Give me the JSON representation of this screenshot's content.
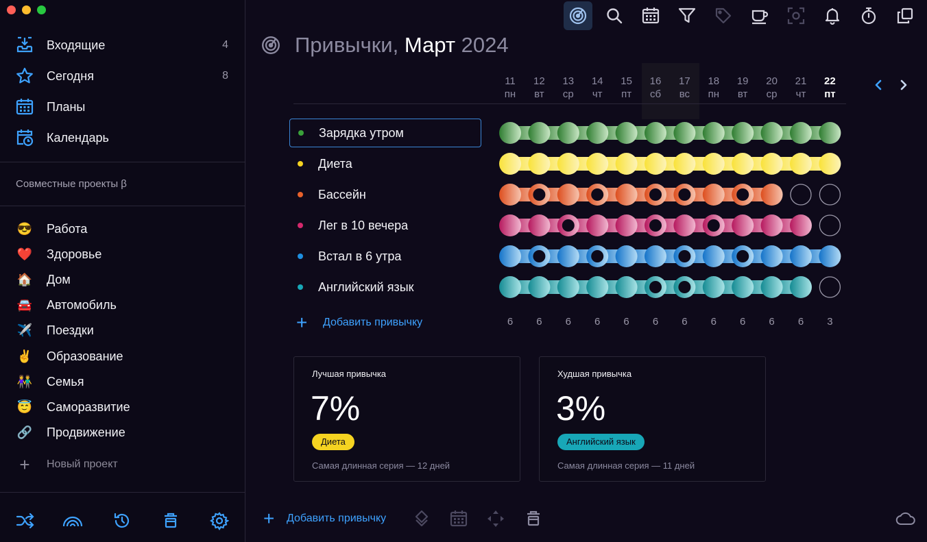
{
  "window": {
    "traffic_lights": [
      "#ff5f57",
      "#febc2e",
      "#28c840"
    ]
  },
  "sidebar": {
    "nav": [
      {
        "label": "Входящие",
        "count": "4",
        "icon": "inbox-icon"
      },
      {
        "label": "Сегодня",
        "count": "8",
        "icon": "star-icon"
      },
      {
        "label": "Планы",
        "count": "",
        "icon": "calendar-grid-icon"
      },
      {
        "label": "Календарь",
        "count": "",
        "icon": "calendar-clock-icon"
      }
    ],
    "shared_title": "Совместные проекты β",
    "projects": [
      {
        "label": "Работа",
        "emoji": "😎"
      },
      {
        "label": "Здоровье",
        "emoji": "❤️"
      },
      {
        "label": "Дом",
        "emoji": "🏠"
      },
      {
        "label": "Автомобиль",
        "emoji": "🚘"
      },
      {
        "label": "Поездки",
        "emoji": "✈️"
      },
      {
        "label": "Образование",
        "emoji": "✌️"
      },
      {
        "label": "Семья",
        "emoji": "👫"
      },
      {
        "label": "Саморазвитие",
        "emoji": "😇"
      },
      {
        "label": "Продвижение",
        "emoji": "🔗"
      }
    ],
    "new_project": "Новый проект",
    "bottom_icons": [
      "shuffle-icon",
      "rainbow-icon",
      "history-icon",
      "trash-icon",
      "gear-icon"
    ]
  },
  "toolbar": {
    "icons": [
      "habits-radar-icon",
      "search-icon",
      "calendar-icon",
      "filter-icon",
      "tag-icon",
      "coffee-icon",
      "focus-icon",
      "bell-icon",
      "timer-icon",
      "windows-icon"
    ],
    "active": "habits-radar-icon"
  },
  "header": {
    "title_part1": "Привычки, ",
    "title_part2": "Март",
    "title_part3": " 2024"
  },
  "days": [
    {
      "num": "11",
      "wd": "пн"
    },
    {
      "num": "12",
      "wd": "вт"
    },
    {
      "num": "13",
      "wd": "ср"
    },
    {
      "num": "14",
      "wd": "чт"
    },
    {
      "num": "15",
      "wd": "пт"
    },
    {
      "num": "16",
      "wd": "сб"
    },
    {
      "num": "17",
      "wd": "вс"
    },
    {
      "num": "18",
      "wd": "пн"
    },
    {
      "num": "19",
      "wd": "вт"
    },
    {
      "num": "20",
      "wd": "ср"
    },
    {
      "num": "21",
      "wd": "чт"
    },
    {
      "num": "22",
      "wd": "пт"
    }
  ],
  "habits": [
    {
      "name": "Зарядка утром",
      "color": "#3aa13a",
      "from": "#2f7d31",
      "to": "#c8e6c4",
      "done": [
        1,
        1,
        1,
        1,
        1,
        1,
        1,
        1,
        1,
        1,
        1,
        1
      ]
    },
    {
      "name": "Диета",
      "color": "#f5d321",
      "from": "#f9e23a",
      "to": "#fdf3b8",
      "done": [
        1,
        1,
        1,
        1,
        1,
        1,
        1,
        1,
        1,
        1,
        1,
        1
      ]
    },
    {
      "name": "Бассейн",
      "color": "#e8612b",
      "from": "#dd4e1e",
      "to": "#f6c3ae",
      "done": [
        1,
        0,
        1,
        0,
        1,
        0,
        0,
        1,
        0,
        1,
        0,
        0
      ]
    },
    {
      "name": "Лег в 10 вечера",
      "color": "#d4286c",
      "from": "#b6195e",
      "to": "#f1b7d0",
      "done": [
        1,
        1,
        0,
        1,
        1,
        0,
        1,
        0,
        1,
        1,
        1,
        0
      ]
    },
    {
      "name": "Встал в 6 утра",
      "color": "#1e8fe0",
      "from": "#1473c9",
      "to": "#b3dbf5",
      "done": [
        1,
        0,
        1,
        0,
        1,
        1,
        0,
        1,
        0,
        1,
        1,
        1
      ]
    },
    {
      "name": "Английский язык",
      "color": "#18a7b7",
      "from": "#148b93",
      "to": "#a9e3e6",
      "done": [
        1,
        1,
        1,
        1,
        1,
        0,
        0,
        1,
        1,
        1,
        1,
        0
      ]
    }
  ],
  "add_habit": "Добавить привычку",
  "counts": [
    "6",
    "6",
    "6",
    "6",
    "6",
    "6",
    "6",
    "6",
    "6",
    "6",
    "6",
    "3"
  ],
  "best": {
    "title": "Лучшая привычка",
    "percent": "7%",
    "habit": "Диета",
    "habit_color": "#f5d321",
    "streak": "Самая длинная серия — 12 дней"
  },
  "worst": {
    "title": "Худшая привычка",
    "percent": "3%",
    "habit": "Английский язык",
    "habit_color": "#18a7b7",
    "streak": "Самая длинная серия — 11 дней"
  },
  "bottom_bar": {
    "add_label": "Добавить привычку",
    "icons": [
      "diamond-stack-icon",
      "calendar-icon",
      "move-icon",
      "trash-icon",
      "cloud-icon"
    ]
  }
}
